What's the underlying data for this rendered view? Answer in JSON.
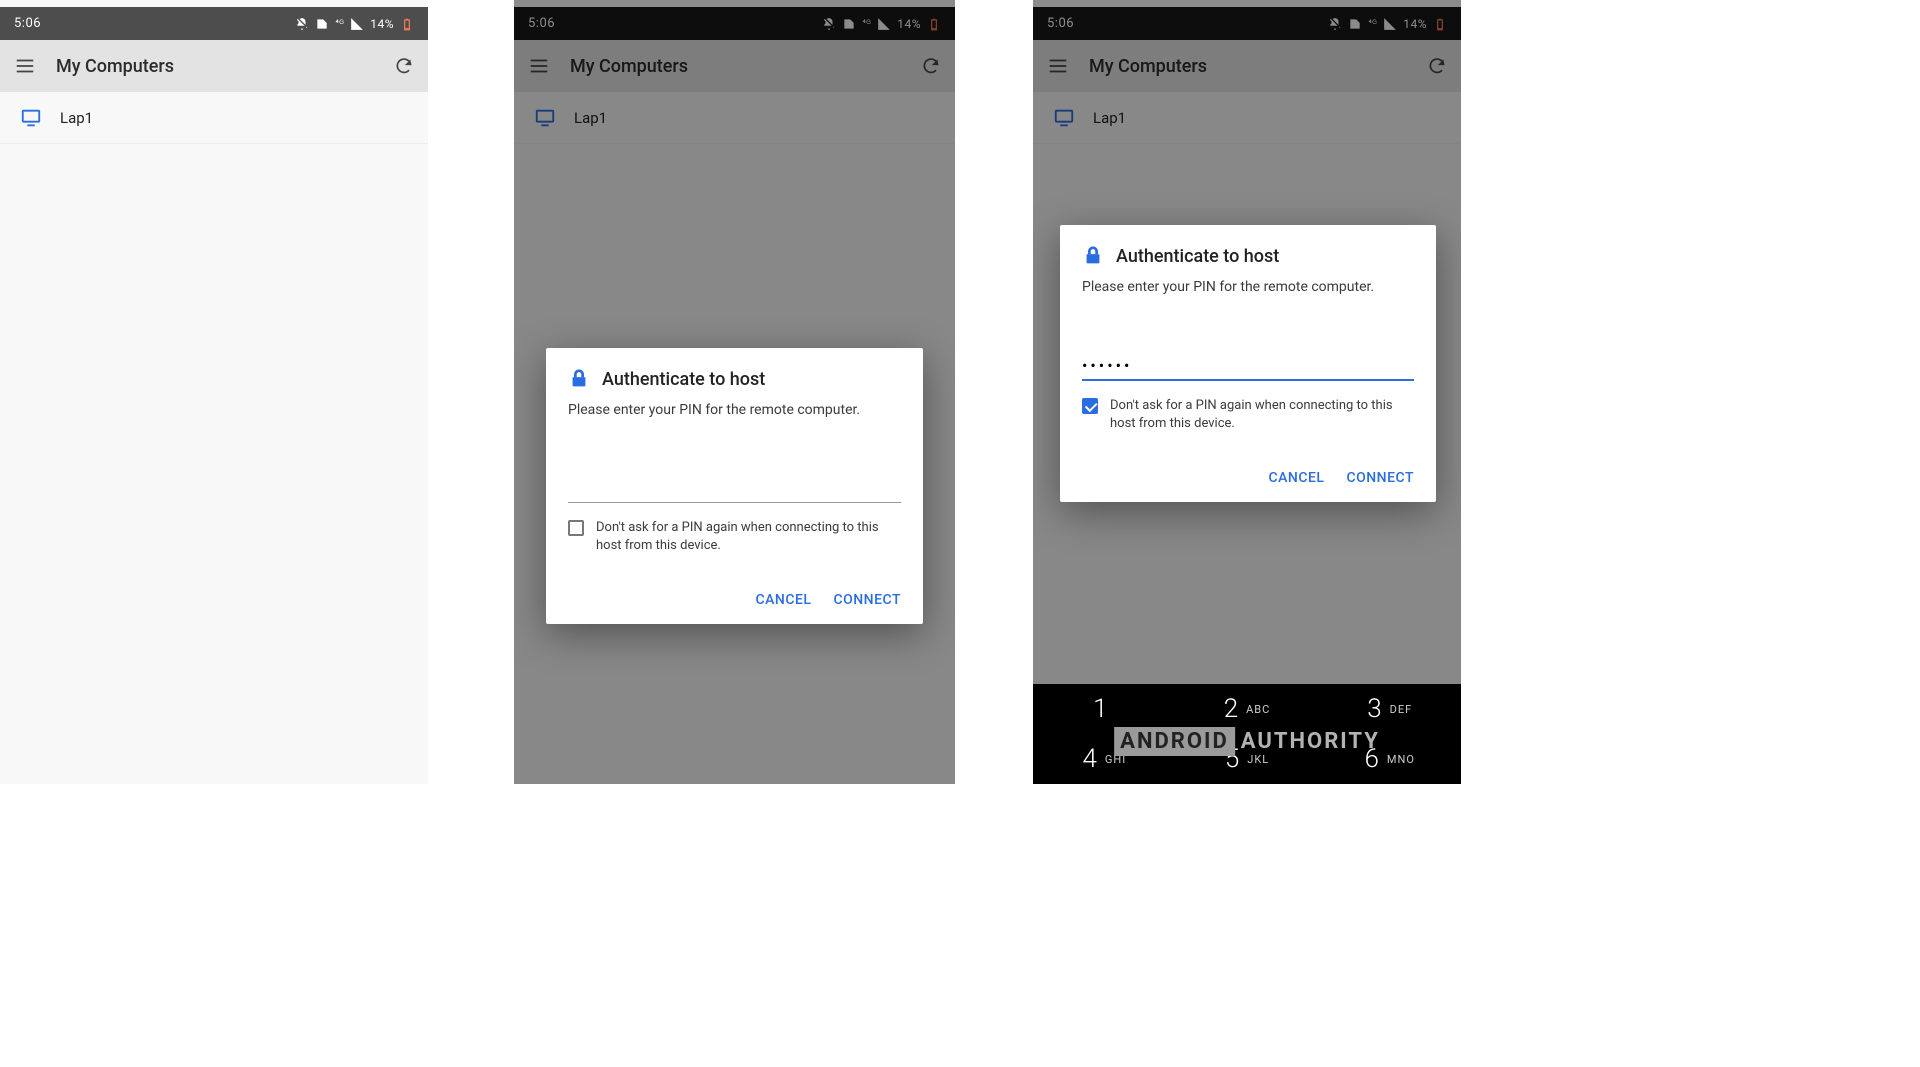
{
  "status": {
    "time": "5:06",
    "battery_text": "14%"
  },
  "app_bar": {
    "title": "My Computers"
  },
  "host_row": {
    "name": "Lap1"
  },
  "dialog": {
    "title": "Authenticate to host",
    "message": "Please enter your PIN for the remote computer.",
    "checkbox_label": "Don't ask for a PIN again when connecting to this host from this device.",
    "pin_masked": "••••••",
    "cancel": "CANCEL",
    "connect": "CONNECT"
  },
  "keyboard": {
    "rows": [
      [
        {
          "d": "1",
          "s": ""
        },
        {
          "d": "2",
          "s": "ABC"
        },
        {
          "d": "3",
          "s": "DEF"
        }
      ],
      [
        {
          "d": "4",
          "s": "GHI"
        },
        {
          "d": "5",
          "s": "JKL"
        },
        {
          "d": "6",
          "s": "MNO"
        }
      ]
    ]
  },
  "watermark": {
    "part1": "ANDROID",
    "part2": "AUTHORITY"
  }
}
